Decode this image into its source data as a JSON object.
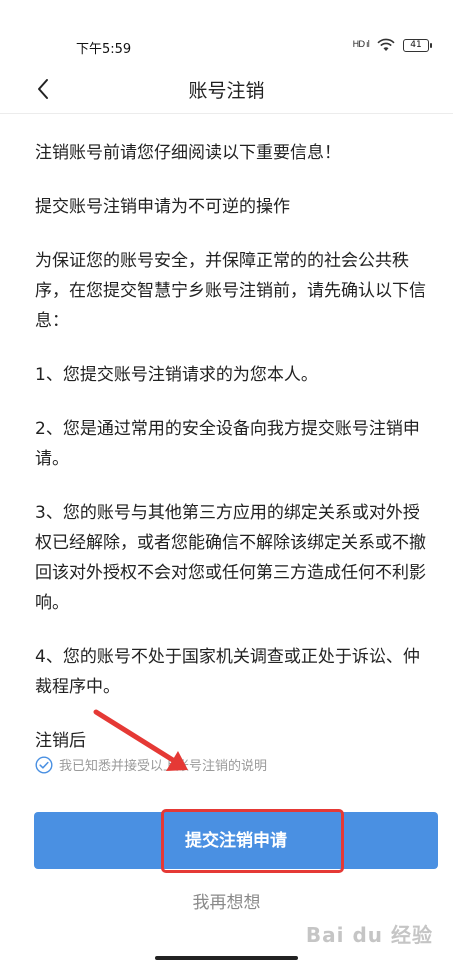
{
  "status_bar": {
    "time": "下午5:59",
    "signal": "HD ıl",
    "battery": "41"
  },
  "nav": {
    "title": "账号注销"
  },
  "content": {
    "paragraphs": [
      "注销账号前请您仔细阅读以下重要信息！",
      "提交账号注销申请为不可逆的操作",
      "为保证您的账号安全，并保障正常的的社会公共秩序，在您提交智慧宁乡账号注销前，请先确认以下信息：",
      "1、您提交账号注销请求的为您本人。",
      "2、您是通过常用的安全设备向我方提交账号注销申请。",
      "3、您的账号与其他第三方应用的绑定关系或对外授权已经解除，或者您能确信不解除该绑定关系或不撤回该对外授权不会对您或任何第三方造成任何不利影响。",
      "4、您的账号不处于国家机关调查或正处于诉讼、仲裁程序中。",
      "注销后"
    ]
  },
  "agreement": {
    "text": "我已知悉并接受以上账号注销的说明",
    "checked": true
  },
  "actions": {
    "submit_label": "提交注销申请",
    "cancel_label": "我再想想"
  },
  "watermark": {
    "text": "Bai du 经验"
  },
  "colors": {
    "primary": "#4a90e2",
    "annotation": "#e53935",
    "muted": "#9a9a9a"
  }
}
